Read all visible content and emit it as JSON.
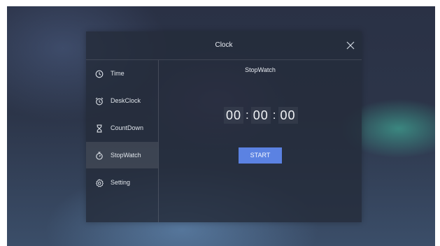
{
  "window": {
    "title": "Clock"
  },
  "sidebar": {
    "items": [
      {
        "label": "Time",
        "icon": "clock-icon",
        "active": false
      },
      {
        "label": "DeskClock",
        "icon": "alarm-clock-icon",
        "active": false
      },
      {
        "label": "CountDown",
        "icon": "hourglass-icon",
        "active": false
      },
      {
        "label": "StopWatch",
        "icon": "stopwatch-icon",
        "active": true
      },
      {
        "label": "Setting",
        "icon": "settings-icon",
        "active": false
      }
    ]
  },
  "stopwatch": {
    "title": "StopWatch",
    "hours": "00",
    "minutes": "00",
    "seconds": "00",
    "separator": ":",
    "start_label": "START"
  },
  "colors": {
    "accent": "#5b82e2",
    "panel": "#242c3a",
    "text": "#e9edf3"
  }
}
